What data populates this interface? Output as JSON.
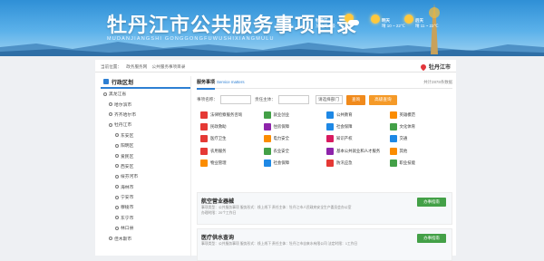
{
  "banner": {
    "title": "牡丹江市公共服务事项目录",
    "subtitle": "MUDANJIANGSHI GONGGONGFUWUSHIXIANGMULU",
    "weather": [
      {
        "day": "牡丹江",
        "desc": "东北风 3级",
        "icon": "sun-cloud-icon"
      },
      {
        "day": "明天",
        "desc": "晴 10 ~ 22℃",
        "icon": "sun-icon"
      },
      {
        "day": "后天",
        "desc": "晴 11 ~ 22℃",
        "icon": "sun-icon"
      }
    ]
  },
  "breadcrumb": [
    "当前位置：",
    "政务服务网",
    "公共服务事项目录"
  ],
  "city": "牡丹江市",
  "sidebar": {
    "title": "行政区划",
    "items": [
      {
        "label": "黑龙江省",
        "level": 1
      },
      {
        "label": "哈尔滨市",
        "level": 2
      },
      {
        "label": "齐齐哈尔市",
        "level": 2
      },
      {
        "label": "牡丹江市",
        "level": 2
      },
      {
        "label": "东安区",
        "level": 3
      },
      {
        "label": "阳明区",
        "level": 3
      },
      {
        "label": "爱民区",
        "level": 3
      },
      {
        "label": "西安区",
        "level": 3
      },
      {
        "label": "绥芬河市",
        "level": 3
      },
      {
        "label": "海林市",
        "level": 3
      },
      {
        "label": "宁安市",
        "level": 3
      },
      {
        "label": "穆棱市",
        "level": 3
      },
      {
        "label": "东宁市",
        "level": 3
      },
      {
        "label": "林口县",
        "level": 3
      },
      {
        "label": "佳木斯市",
        "level": 2
      }
    ]
  },
  "main": {
    "tab": "服务事项",
    "tab_en": "Service matters",
    "count": "共计2878条数据",
    "search": {
      "name_label": "事项名称：",
      "subject_label": "责任主体：",
      "select_label": "请选择部门",
      "query_btn": "查询",
      "adv_btn": "高级查询"
    },
    "categories": [
      {
        "label": "法律检察服务咨询",
        "color": "#e53935"
      },
      {
        "label": "就业创业",
        "color": "#43a047"
      },
      {
        "label": "公共教育",
        "color": "#1e88e5"
      },
      {
        "label": "英雄模范",
        "color": "#fb8c00"
      },
      {
        "label": "民政救助",
        "color": "#e53935"
      },
      {
        "label": "住房保障",
        "color": "#8e24aa"
      },
      {
        "label": "社会保障",
        "color": "#1e88e5"
      },
      {
        "label": "文化体育",
        "color": "#43a047"
      },
      {
        "label": "医疗卫生",
        "color": "#e53935"
      },
      {
        "label": "电力安全",
        "color": "#fb8c00"
      },
      {
        "label": "知识产权",
        "color": "#d81b60"
      },
      {
        "label": "交通",
        "color": "#1e88e5"
      },
      {
        "label": "农用服务",
        "color": "#e53935"
      },
      {
        "label": "农业安全",
        "color": "#43a047"
      },
      {
        "label": "基本公共就业和人才服务",
        "color": "#8e24aa"
      },
      {
        "label": "其他",
        "color": "#fb8c00"
      },
      {
        "label": "物业管理",
        "color": "#fb8c00"
      },
      {
        "label": "社会保障",
        "color": "#1e88e5"
      },
      {
        "label": "防汛应急",
        "color": "#e53935"
      },
      {
        "label": "职业技能",
        "color": "#43a047"
      }
    ],
    "items": [
      {
        "title": "航空营业器械",
        "meta1": "事项类型：公共服务事项  服务形式：线上线下  责任主体：牡丹江市人民政府安全生产委员会办公室",
        "meta2": "办理时限：20个工作日",
        "action": "办事指南"
      },
      {
        "title": "医疗供水查询",
        "meta1": "事项类型：公共服务事项  服务形式：线上线下  责任主体：牡丹江市自来水有限公司  法定时限：1工作日",
        "meta2": "",
        "action": "办事指南"
      }
    ]
  }
}
